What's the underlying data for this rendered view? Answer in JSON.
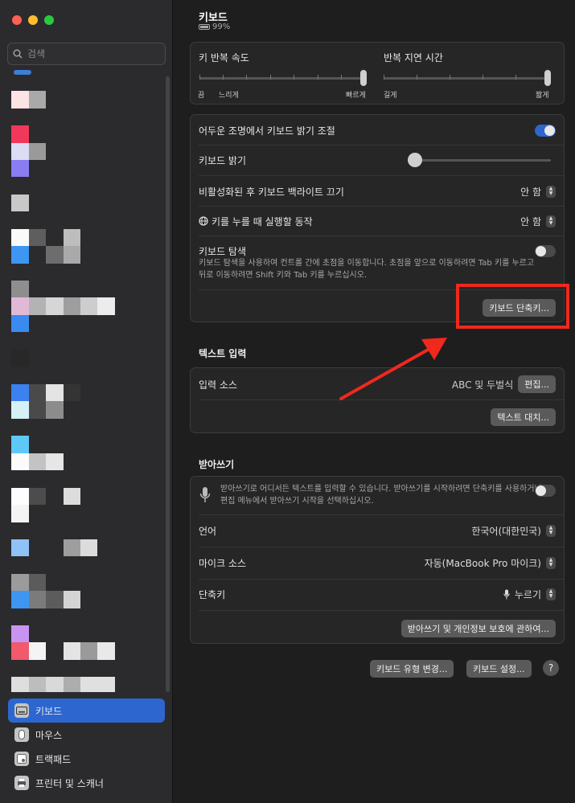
{
  "sidebar": {
    "search_placeholder": "검색",
    "items": [
      {
        "label": "키보드",
        "icon": "keyboard-icon",
        "active": true
      },
      {
        "label": "마우스",
        "icon": "mouse-icon",
        "active": false
      },
      {
        "label": "트랙패드",
        "icon": "trackpad-icon",
        "active": false
      },
      {
        "label": "프린터 및 스캐너",
        "icon": "printer-icon",
        "active": false
      }
    ]
  },
  "header": {
    "title": "키보드",
    "battery": "99%"
  },
  "repeat": {
    "key_repeat_label": "키 반복 속도",
    "delay_label": "반복 지연 시간",
    "repeat_min": "끔",
    "repeat_slow": "느리게",
    "repeat_fast": "빠르게",
    "delay_long": "길게",
    "delay_short": "짧게"
  },
  "lighting": {
    "adjust_label": "어두운 조명에서 키보드 밝기 조절",
    "brightness_label": "키보드 밝기",
    "backlight_off_label": "비활성화된 후 키보드 백라이트 끄기",
    "backlight_off_value": "안 함",
    "globe_label": "키를 누를 때 실행할 동작",
    "globe_value": "안 함",
    "nav_label": "키보드 탐색",
    "nav_desc": "키보드 탐색을 사용하여 컨트롤 간에 초점을 이동합니다. 초점을 앞으로 이동하려면 Tab 키를 누르고 뒤로 이동하려면 Shift 키와 Tab 키를 누르십시오.",
    "shortcuts_button": "키보드 단축키..."
  },
  "text_input": {
    "section_title": "텍스트 입력",
    "source_label": "입력 소스",
    "source_value": "ABC 및 두벌식",
    "edit_button": "편집...",
    "replace_button": "텍스트 대치..."
  },
  "dictation": {
    "section_title": "받아쓰기",
    "desc": "받아쓰기로 어디서든 텍스트를 입력할 수 있습니다. 받아쓰기를 시작하려면 단축키를 사용하거나 편집 메뉴에서 받아쓰기 시작을 선택하십시오.",
    "language_label": "언어",
    "language_value": "한국어(대한민국)",
    "mic_label": "마이크 소스",
    "mic_value": "자동(MacBook Pro 마이크)",
    "shortcut_label": "단축키",
    "shortcut_value": "누르기",
    "privacy_button": "받아쓰기 및 개인정보 보호에 관하여..."
  },
  "footer": {
    "change_type_button": "키보드 유형 변경...",
    "setup_button": "키보드 설정...",
    "help_label": "?"
  },
  "colors": {
    "accent": "#2e66d0",
    "highlight": "#f0281e"
  }
}
